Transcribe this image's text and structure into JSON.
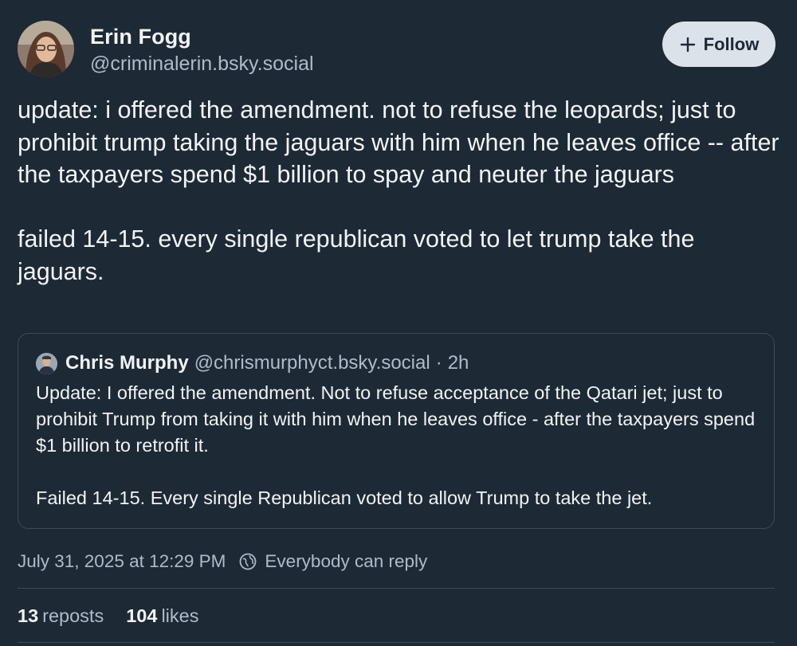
{
  "author": {
    "display_name": "Erin Fogg",
    "handle": "@criminalerin.bsky.social",
    "avatar": "avatar"
  },
  "follow_button": {
    "label": "Follow",
    "icon": "plus-icon"
  },
  "post": {
    "paragraphs": [
      "update: i offered the amendment. not to refuse the leopards; just to prohibit trump taking the jaguars with him when he leaves office -- after the taxpayers spend $1 billion to spay and neuter the jaguars",
      "failed 14-15. every single republican voted to let trump take the jaguars."
    ]
  },
  "quote": {
    "display_name": "Chris Murphy",
    "handle": "@chrismurphyct.bsky.social",
    "separator": "·",
    "time": "2h",
    "paragraphs": [
      "Update: I offered the amendment. Not to refuse acceptance of the Qatari jet; just to prohibit Trump from taking it with him when he leaves office - after the taxpayers spend $1 billion to retrofit it.",
      "Failed 14-15. Every single Republican voted to allow Trump to take the jet."
    ]
  },
  "meta": {
    "timestamp": "July 31, 2025 at 12:29 PM",
    "reply_setting": "Everybody can reply",
    "reply_icon": "globe-icon"
  },
  "stats": {
    "reposts_count": "13",
    "reposts_label": "reposts",
    "likes_count": "104",
    "likes_label": "likes"
  },
  "colors": {
    "background": "#1e2936",
    "text_primary": "#f1f3f5",
    "text_secondary": "#aebbc9",
    "border": "#3d4a5a",
    "follow_button_bg": "#dce2ea"
  }
}
